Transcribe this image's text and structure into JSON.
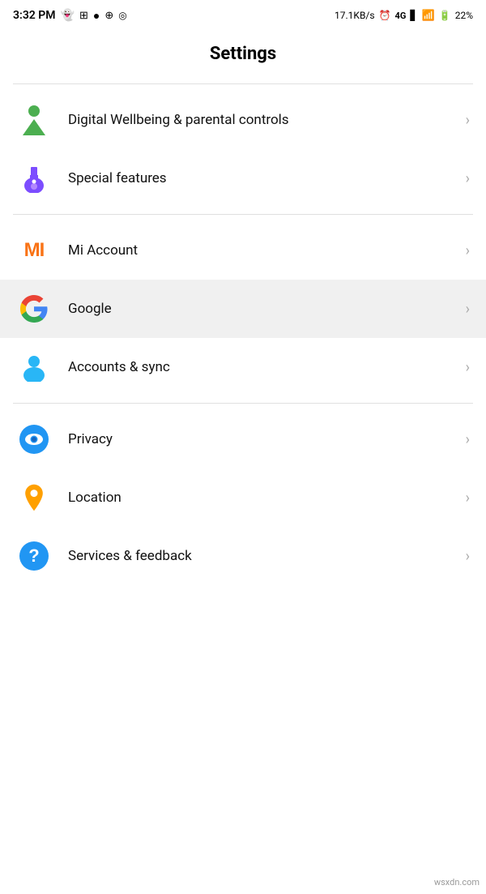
{
  "status_bar": {
    "time": "3:32 PM",
    "network_speed": "17.1KB/s",
    "battery_percent": "22%"
  },
  "page": {
    "title": "Settings"
  },
  "sections": [
    {
      "id": "section1",
      "items": [
        {
          "id": "digital-wellbeing",
          "label": "Digital Wellbeing & parental controls",
          "icon_type": "digital-wellbeing"
        },
        {
          "id": "special-features",
          "label": "Special features",
          "icon_type": "special-features"
        }
      ]
    },
    {
      "id": "section2",
      "items": [
        {
          "id": "mi-account",
          "label": "Mi Account",
          "icon_type": "mi-account"
        },
        {
          "id": "google",
          "label": "Google",
          "icon_type": "google",
          "highlighted": true
        },
        {
          "id": "accounts-sync",
          "label": "Accounts & sync",
          "icon_type": "accounts-sync"
        }
      ]
    },
    {
      "id": "section3",
      "items": [
        {
          "id": "privacy",
          "label": "Privacy",
          "icon_type": "privacy"
        },
        {
          "id": "location",
          "label": "Location",
          "icon_type": "location"
        },
        {
          "id": "services-feedback",
          "label": "Services & feedback",
          "icon_type": "services"
        }
      ]
    }
  ],
  "chevron": "›",
  "watermark": "wsxdn.com"
}
